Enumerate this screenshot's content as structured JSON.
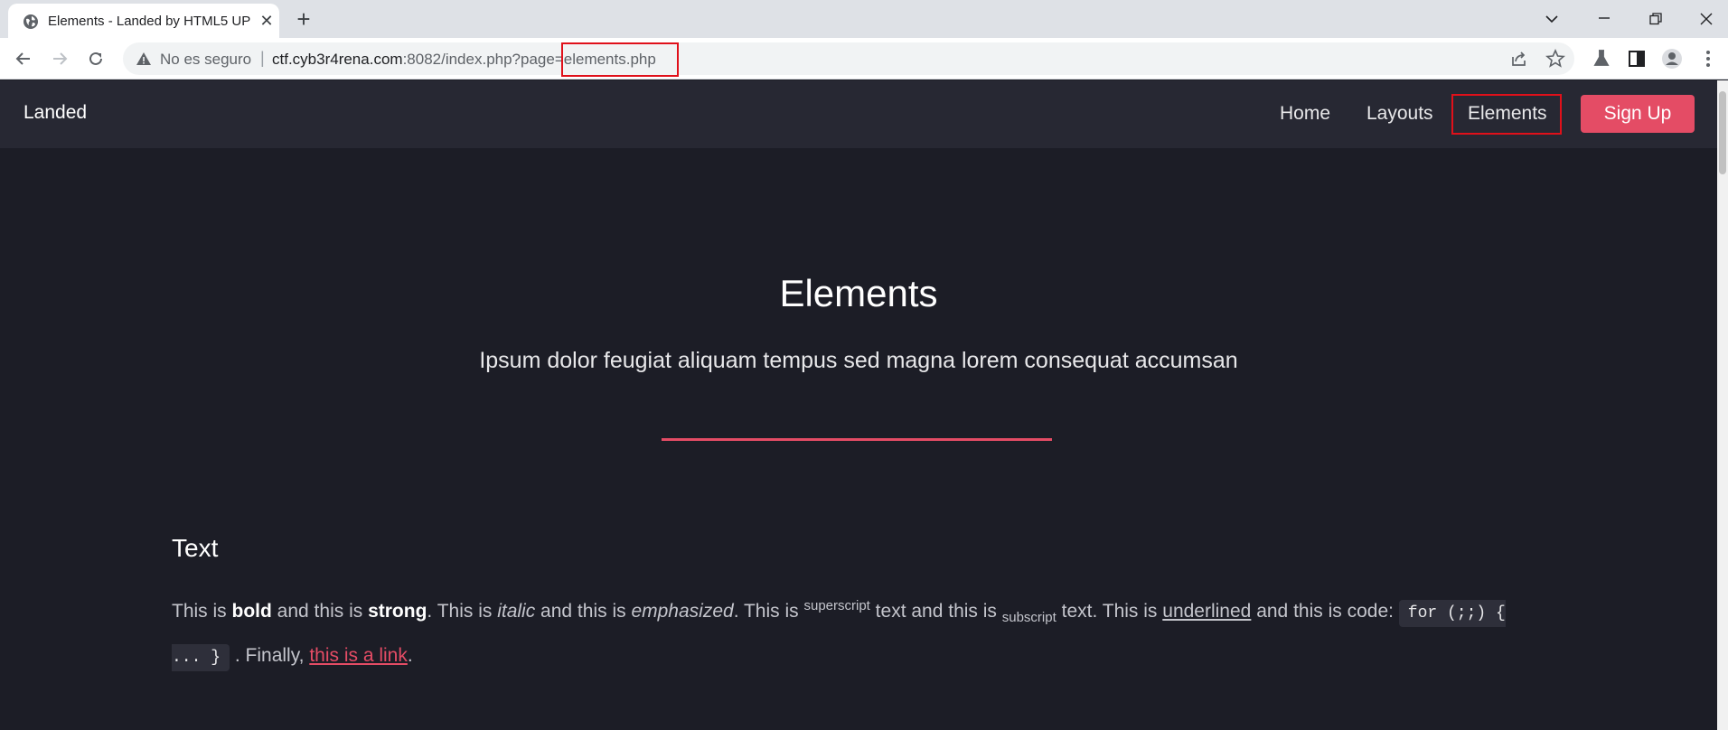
{
  "browser": {
    "tab_title": "Elements - Landed by HTML5 UP",
    "security_label": "No es seguro",
    "url_host": "ctf.cyb3r4rena.com",
    "url_rest": ":8082/index.php?page=elements.php"
  },
  "site": {
    "logo": "Landed",
    "nav": {
      "home": "Home",
      "layouts": "Layouts",
      "elements": "Elements",
      "signup": "Sign Up"
    }
  },
  "hero": {
    "title": "Elements",
    "subtitle": "Ipsum dolor feugiat aliquam tempus sed magna lorem consequat accumsan"
  },
  "text_section": {
    "title": "Text",
    "p1": "This is ",
    "bold": "bold",
    "p2": " and this is ",
    "strong": "strong",
    "p3": ". This is ",
    "italic": "italic",
    "p4": " and this is ",
    "emphasized": "emphasized",
    "p5": ". This is ",
    "superscript": "superscript",
    "p6": " text and this is ",
    "subscript": "subscript",
    "p7": " text. This is ",
    "underlined": "underlined",
    "p8": " and this is code: ",
    "code": "for (;;) { ... }",
    "p9": " . Finally, ",
    "link": "this is a link",
    "p10": "."
  },
  "colors": {
    "accent": "#e44c65",
    "page_bg": "#1c1d26",
    "header_bg": "#272833",
    "highlight": "#e0101a"
  }
}
